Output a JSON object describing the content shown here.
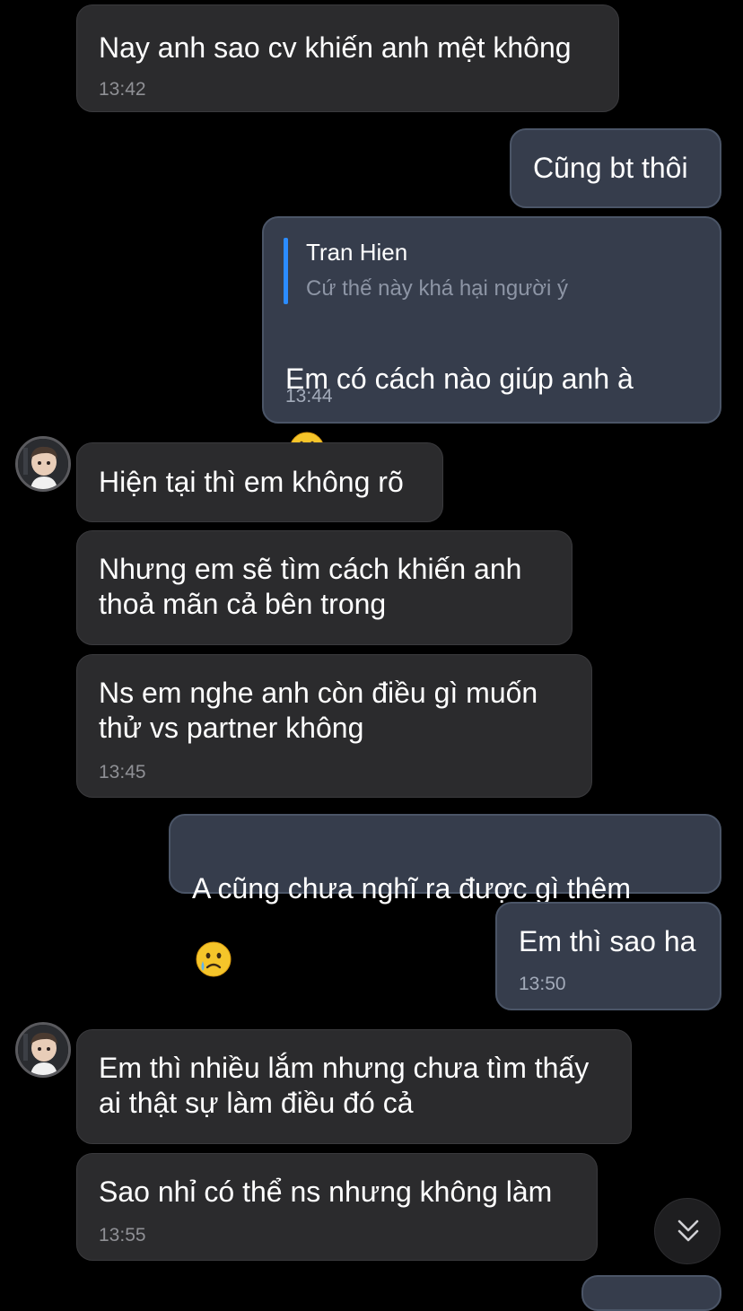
{
  "messages": [
    {
      "text": "Nay anh sao cv khiến anh mệt không",
      "time": "13:42"
    },
    {
      "text": "Cũng bt thôi"
    },
    {
      "reply_name": "Tran Hien",
      "reply_text": "Cứ thế này khá hại người ý",
      "text": "Em có cách nào giúp anh à",
      "time": "13:44",
      "emoji": "grinning-face"
    },
    {
      "text": "Hiện tại thì em không rõ"
    },
    {
      "text": "Nhưng em sẽ tìm cách khiến anh\nthoả mãn cả bên trong"
    },
    {
      "text": "Ns em nghe anh còn điều gì muốn\nthử vs partner không",
      "time": "13:45"
    },
    {
      "text": "A cũng chưa nghĩ ra được gì thêm",
      "emoji": "crying-face"
    },
    {
      "text": "Em thì sao ha",
      "time": "13:50"
    },
    {
      "text": "Em thì nhiều lắm nhưng chưa tìm thấy\nai thật sự làm điều đó cả"
    },
    {
      "text": "Sao nhỉ có thể ns nhưng không làm",
      "time": "13:55"
    }
  ],
  "icons": {
    "avatar": "contact-avatar",
    "scroll": "double-chevron-down-icon",
    "emoji_smile": "grinning-face-emoji",
    "emoji_cry": "crying-face-emoji"
  },
  "colors": {
    "background": "#000000",
    "incoming_bubble": "#2b2b2d",
    "outgoing_bubble": "#363d4c",
    "reply_accent": "#2b8cff"
  }
}
